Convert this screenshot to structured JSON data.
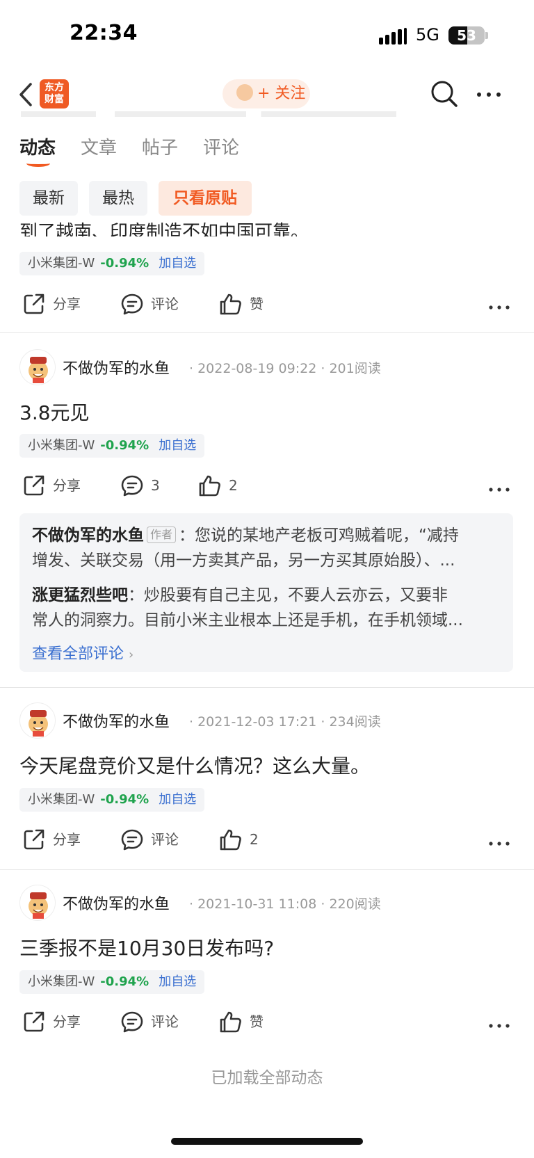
{
  "status_bar": {
    "time": "22:34",
    "network": "5G",
    "battery": "53"
  },
  "header": {
    "logo_text_1": "东方",
    "logo_text_2": "财富",
    "follow_label": "+ 关注"
  },
  "tabs": [
    {
      "label": "动态"
    },
    {
      "label": "文章"
    },
    {
      "label": "帖子"
    },
    {
      "label": "评论"
    }
  ],
  "filters": [
    {
      "label": "最新"
    },
    {
      "label": "最热"
    },
    {
      "label": "只看原贴"
    }
  ],
  "first_post": {
    "text_fragment": "到了越南、印度制造不如中国可靠。",
    "stock": {
      "name": "小米集团-W",
      "change": "-0.94%",
      "add": "加自选"
    },
    "actions": {
      "share": "分享",
      "comment": "评论",
      "like": "赞"
    }
  },
  "posts": [
    {
      "author": "不做伪军的水鱼",
      "date": "2022-08-19 09:22",
      "reads": "201阅读",
      "text": "3.8元见",
      "stock": {
        "name": "小米集团-W",
        "change": "-0.94%",
        "add": "加自选"
      },
      "actions": {
        "share": "分享",
        "comment": "3",
        "like": "2"
      },
      "comments": [
        {
          "author": "不做伪军的水鱼",
          "tag": "作者",
          "text": "：您说的某地产老板可鸡贼着呢，“减持",
          "text2": "增发、关联交易（用一方卖其产品，另一方买其原始股）、..."
        },
        {
          "author": "涨更猛烈些吧",
          "text": "：炒股要有自己主见，不要人云亦云，又要非",
          "text2": "常人的洞察力。目前小米主业根本上还是手机，在手机领域..."
        }
      ],
      "view_all": "查看全部评论"
    },
    {
      "author": "不做伪军的水鱼",
      "date": "2021-12-03 17:21",
      "reads": "234阅读",
      "text": "今天尾盘竞价又是什么情况？这么大量。",
      "stock": {
        "name": "小米集团-W",
        "change": "-0.94%",
        "add": "加自选"
      },
      "actions": {
        "share": "分享",
        "comment": "评论",
        "like": "2"
      }
    },
    {
      "author": "不做伪军的水鱼",
      "date": "2021-10-31 11:08",
      "reads": "220阅读",
      "text": "三季报不是10月30日发布吗?",
      "stock": {
        "name": "小米集团-W",
        "change": "-0.94%",
        "add": "加自选"
      },
      "actions": {
        "share": "分享",
        "comment": "评论",
        "like": "赞"
      }
    }
  ],
  "footer": {
    "loaded_text": "已加载全部动态"
  },
  "colors": {
    "accent": "#f15a22",
    "down": "#1fa34d",
    "link": "#3a6fd0"
  }
}
